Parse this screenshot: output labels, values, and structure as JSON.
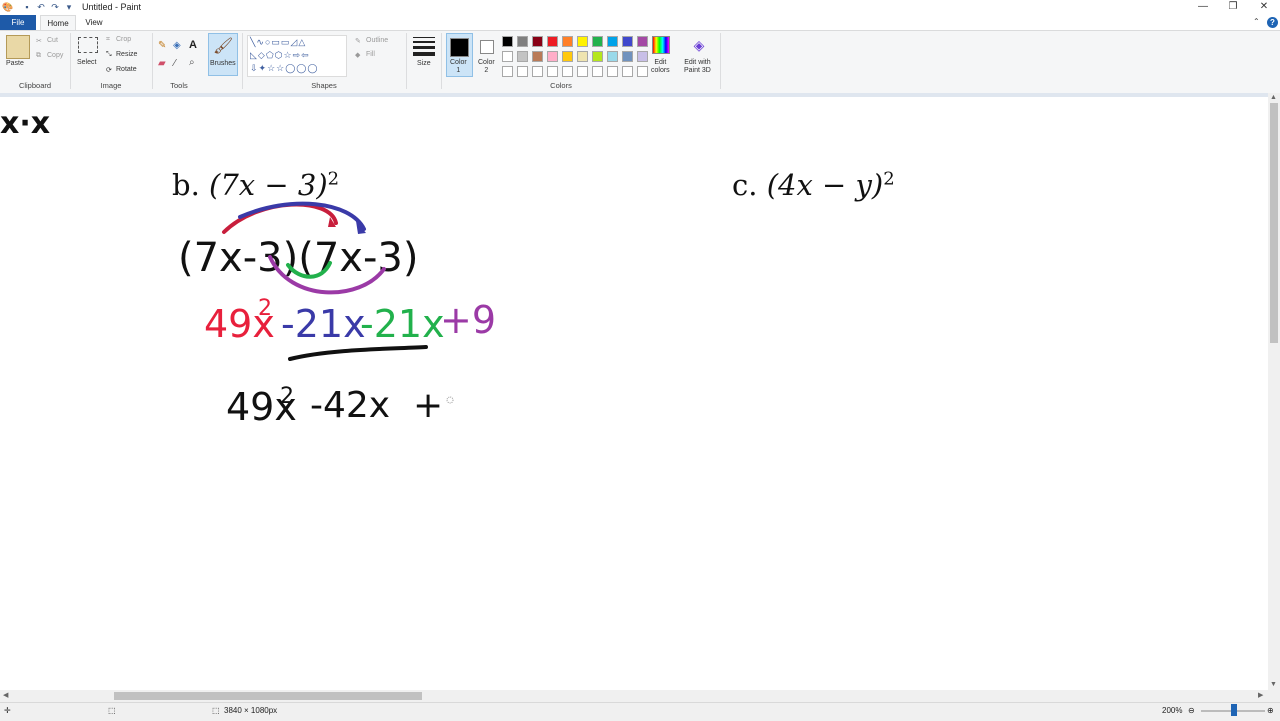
{
  "window": {
    "title": "Untitled - Paint"
  },
  "menu": {
    "file": "File",
    "home": "Home",
    "view": "View"
  },
  "ribbon": {
    "clipboard": {
      "paste": "Paste",
      "cut": "Cut",
      "copy": "Copy",
      "label": "Clipboard"
    },
    "image": {
      "select": "Select",
      "crop": "Crop",
      "resize": "Resize",
      "rotate": "Rotate",
      "label": "Image"
    },
    "tools": {
      "label": "Tools"
    },
    "brushes": {
      "label": "Brushes"
    },
    "shapes": {
      "outline": "Outline",
      "fill": "Fill",
      "label": "Shapes"
    },
    "size": {
      "label": "Size"
    },
    "colors": {
      "color1": "Color\n1",
      "color2": "Color\n2",
      "edit_colors": "Edit\ncolors",
      "edit_paint3d": "Edit with\nPaint 3D",
      "label": "Colors",
      "palette_row1": [
        "#000000",
        "#7f7f7f",
        "#880015",
        "#ed1c24",
        "#ff7f27",
        "#fff200",
        "#22b14c",
        "#00a2e8",
        "#3f48cc",
        "#a349a4"
      ],
      "palette_row2": [
        "#ffffff",
        "#c3c3c3",
        "#b97a57",
        "#ffaec9",
        "#ffc90e",
        "#efe4b0",
        "#b5e61d",
        "#99d9ea",
        "#7092be",
        "#c8bfe7"
      ]
    }
  },
  "canvas": {
    "top_left_fragment": "x·x",
    "problem_b": {
      "label": "b.",
      "expr": "(7x − 3)",
      "exp": "2"
    },
    "problem_c": {
      "label": "c.",
      "expr": "(4x − y)",
      "exp": "2"
    },
    "hw_factored": "(7x-3)(7x-3)",
    "hw_term1": "49x",
    "hw_term1_exp": "2",
    "hw_term2": "-21x",
    "hw_term3": "-21x",
    "hw_term4": "+9",
    "hw_line2": "49x",
    "hw_line2_exp": "2",
    "hw_line2_rest": "-42x  +",
    "colors": {
      "red": "#e8203c",
      "blue": "#3a3aa8",
      "green": "#22b14c",
      "purple": "#9b3aa6",
      "ink": "#111111"
    }
  },
  "status": {
    "canvas_size": "3840 × 1080px",
    "zoom": "200%"
  }
}
